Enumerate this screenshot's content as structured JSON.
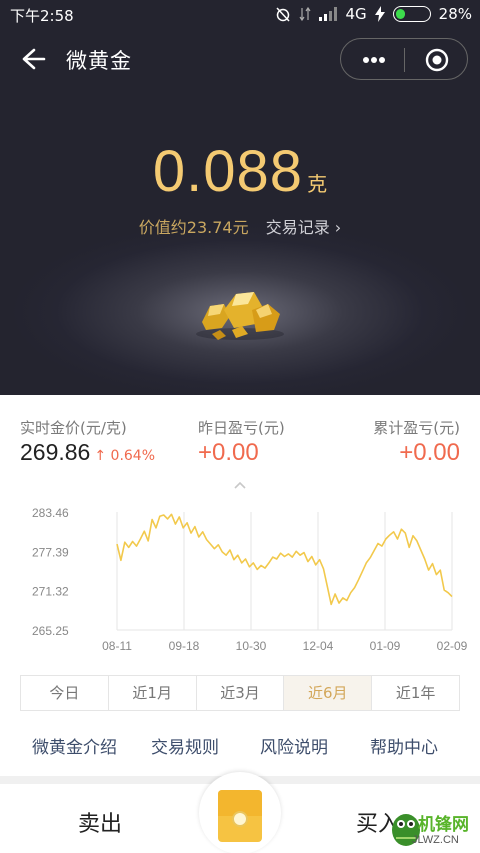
{
  "status_bar": {
    "time": "下午2:58",
    "network": "4G",
    "battery": "28%",
    "battery_level": 0.28
  },
  "navbar": {
    "title": "微黄金"
  },
  "holding": {
    "amount": "0.088",
    "unit": "克",
    "value_text": "价值约23.74元",
    "records_link": "交易记录 ›"
  },
  "stats": {
    "price_label": "实时金价(元/克)",
    "price_value": "269.86",
    "price_change": "↑ 0.64%",
    "yesterday_label": "昨日盈亏(元)",
    "yesterday_value": "+0.00",
    "total_label": "累计盈亏(元)",
    "total_value": "+0.00"
  },
  "chart_data": {
    "type": "line",
    "y_ticks": [
      "283.46",
      "277.39",
      "271.32",
      "265.25"
    ],
    "x_ticks": [
      "08-11",
      "09-18",
      "10-30",
      "12-04",
      "01-09",
      "02-09"
    ],
    "ylim": [
      265.25,
      283.46
    ],
    "color": "#f2c94c",
    "values": [
      278.5,
      276.0,
      278.8,
      278.0,
      278.9,
      278.2,
      279.3,
      280.5,
      279.0,
      282.3,
      281.0,
      282.8,
      283.0,
      282.4,
      283.1,
      281.6,
      282.7,
      281.0,
      281.8,
      280.2,
      281.2,
      279.6,
      280.4,
      279.2,
      278.5,
      277.8,
      278.4,
      277.3,
      276.8,
      277.6,
      276.1,
      276.8,
      275.6,
      276.2,
      275.0,
      275.6,
      274.6,
      275.2,
      274.8,
      275.6,
      276.5,
      276.2,
      277.1,
      276.6,
      277.0,
      276.5,
      277.4,
      276.8,
      277.2,
      275.8,
      276.6,
      275.3,
      276.1,
      274.7,
      272.0,
      269.2,
      270.8,
      269.4,
      270.2,
      269.8,
      271.0,
      271.8,
      273.0,
      274.3,
      275.6,
      276.4,
      277.5,
      278.6,
      278.2,
      279.3,
      279.9,
      280.4,
      279.3,
      280.8,
      280.2,
      278.0,
      279.8,
      279.0,
      277.6,
      276.2,
      274.5,
      275.5,
      273.8,
      274.5,
      271.4,
      271.0,
      270.4
    ]
  },
  "period_tabs": [
    {
      "label": "今日",
      "active": false
    },
    {
      "label": "近1月",
      "active": false
    },
    {
      "label": "近3月",
      "active": false
    },
    {
      "label": "近6月",
      "active": true
    },
    {
      "label": "近1年",
      "active": false
    }
  ],
  "links": [
    "微黄金介绍",
    "交易规则",
    "风险说明",
    "帮助中心"
  ],
  "bottom_bar": {
    "sell": "卖出",
    "buy": "买入"
  },
  "watermark": {
    "text": "机锋网",
    "sub": "JLWZ.CN"
  },
  "colors": {
    "accent_gold": "#f4ca72",
    "profit_red": "#f06a4e",
    "dark_bg": "#262633"
  }
}
